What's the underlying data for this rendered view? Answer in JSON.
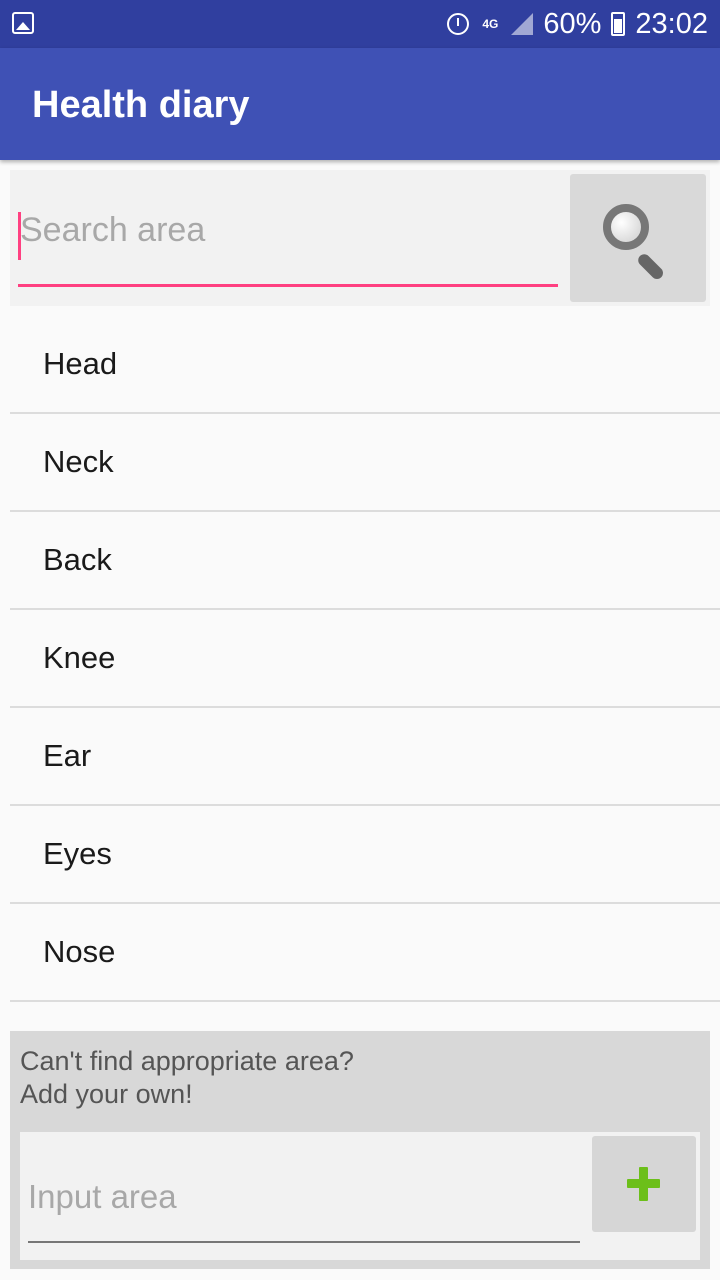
{
  "status_bar": {
    "battery": "60%",
    "time": "23:02",
    "network": "4G",
    "icons": [
      "gallery-icon",
      "alarm-icon",
      "network-4g-icon",
      "signal-icon",
      "battery-charging-icon"
    ]
  },
  "app_bar": {
    "title": "Health diary"
  },
  "search": {
    "placeholder": "Search area",
    "value": "",
    "button_icon": "search-icon"
  },
  "areas": {
    "items": [
      "Head",
      "Neck",
      "Back",
      "Knee",
      "Ear",
      "Eyes",
      "Nose"
    ]
  },
  "add_area": {
    "prompt_line1": "Can't find appropriate area?",
    "prompt_line2": "Add your own!",
    "placeholder": "Input area",
    "value": "",
    "button_icon": "plus-icon"
  },
  "colors": {
    "status_bar": "#303f9f",
    "app_bar": "#3f51b5",
    "accent": "#ff4081",
    "add_icon": "#6cbf1a"
  }
}
